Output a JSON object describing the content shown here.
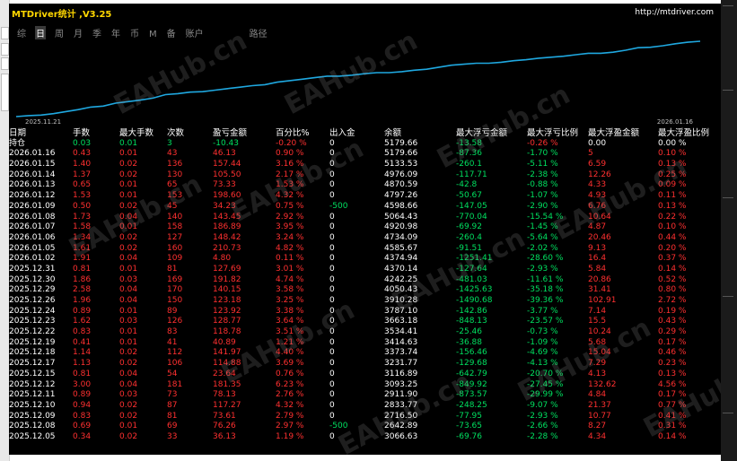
{
  "app": {
    "title": "MTDriver统计 ,V3.25",
    "url": "http://mtdriver.com"
  },
  "tabs": [
    {
      "label": "综",
      "active": false
    },
    {
      "label": "日",
      "active": true
    },
    {
      "label": "周",
      "active": false
    },
    {
      "label": "月",
      "active": false
    },
    {
      "label": "季",
      "active": false
    },
    {
      "label": "年",
      "active": false
    },
    {
      "label": "币",
      "active": false
    },
    {
      "label": "M",
      "active": false
    },
    {
      "label": "备",
      "active": false
    },
    {
      "label": "账户",
      "active": false
    },
    {
      "label": "路径",
      "active": false
    }
  ],
  "watermark": "EAHub.cn",
  "chart_data": {
    "type": "line",
    "x_start_label": "2025.11.21",
    "x_end_label": "2026.01.16",
    "line_color": "#1fa8e0",
    "grid": false,
    "values": [
      0,
      2,
      3,
      6,
      10,
      14,
      19,
      21,
      27,
      30,
      33,
      37,
      44,
      46,
      49,
      50,
      53,
      56,
      59,
      62,
      64,
      69,
      72,
      75,
      78,
      81,
      81,
      83,
      86,
      88,
      88,
      90,
      93,
      95,
      99,
      103,
      105,
      107,
      107,
      109,
      112,
      114,
      117,
      119,
      121,
      124,
      127,
      127,
      129,
      133,
      138,
      139,
      142,
      146,
      149,
      151
    ]
  },
  "table": {
    "headers": [
      "日期",
      "手数",
      "最大手数",
      "次数",
      "盈亏金额",
      "百分比%",
      "出入金",
      "余额",
      "最大浮亏金额",
      "最大浮亏比例",
      "最大浮盈金额",
      "最大浮盈比例"
    ],
    "holding": {
      "date": "持仓",
      "lots": "0.03",
      "max_lots": "0.01",
      "count": "3",
      "pnl": "-10.43",
      "pct": "-0.20 %",
      "io": "0",
      "balance": "5179.66",
      "max_float_loss": "-13.58",
      "max_float_loss_pct": "-0.26 %",
      "max_float_profit": "0.00",
      "max_float_profit_pct": "0.00 %"
    },
    "rows": [
      [
        "2026.01.16",
        "0.43",
        "0.01",
        "43",
        "46.13",
        "0.90 %",
        "0",
        "5179.66",
        "-87.36",
        "-1.70 %",
        "5",
        "0.10 %"
      ],
      [
        "2026.01.15",
        "1.40",
        "0.02",
        "136",
        "157.44",
        "3.16 %",
        "0",
        "5133.53",
        "-260.1",
        "-5.11 %",
        "6.59",
        "0.13 %"
      ],
      [
        "2026.01.14",
        "1.37",
        "0.02",
        "130",
        "105.50",
        "2.17 %",
        "0",
        "4976.09",
        "-117.71",
        "-2.38 %",
        "12.26",
        "0.25 %"
      ],
      [
        "2026.01.13",
        "0.65",
        "0.01",
        "65",
        "73.33",
        "1.53 %",
        "0",
        "4870.59",
        "-42.8",
        "-0.88 %",
        "4.33",
        "0.09 %"
      ],
      [
        "2026.01.12",
        "1.53",
        "0.01",
        "153",
        "198.60",
        "4.32 %",
        "0",
        "4797.26",
        "-50.67",
        "-1.07 %",
        "4.93",
        "0.11 %"
      ],
      [
        "2026.01.09",
        "0.50",
        "0.02",
        "45",
        "34.23",
        "0.75 %",
        "-500",
        "4598.66",
        "-147.05",
        "-2.90 %",
        "6.76",
        "0.13 %"
      ],
      [
        "2026.01.08",
        "1.73",
        "0.04",
        "140",
        "143.45",
        "2.92 %",
        "0",
        "5064.43",
        "-770.04",
        "-15.54 %",
        "10.64",
        "0.22 %"
      ],
      [
        "2026.01.07",
        "1.58",
        "0.01",
        "158",
        "186.89",
        "3.95 %",
        "0",
        "4920.98",
        "-69.92",
        "-1.45 %",
        "4.87",
        "0.10 %"
      ],
      [
        "2026.01.06",
        "1.34",
        "0.02",
        "127",
        "148.42",
        "3.24 %",
        "0",
        "4734.09",
        "-260.4",
        "-5.64 %",
        "20.46",
        "0.44 %"
      ],
      [
        "2026.01.05",
        "1.61",
        "0.02",
        "160",
        "210.73",
        "4.82 %",
        "0",
        "4585.67",
        "-91.51",
        "-2.02 %",
        "9.13",
        "0.20 %"
      ],
      [
        "2026.01.02",
        "1.91",
        "0.04",
        "109",
        "4.80",
        "0.11 %",
        "0",
        "4374.94",
        "-1251.41",
        "-28.60 %",
        "16.4",
        "0.37 %"
      ],
      [
        "2025.12.31",
        "0.81",
        "0.01",
        "81",
        "127.69",
        "3.01 %",
        "0",
        "4370.14",
        "-127.64",
        "-2.93 %",
        "5.84",
        "0.14 %"
      ],
      [
        "2025.12.30",
        "1.86",
        "0.03",
        "169",
        "191.82",
        "4.74 %",
        "0",
        "4242.25",
        "-481.03",
        "-11.61 %",
        "20.86",
        "0.52 %"
      ],
      [
        "2025.12.29",
        "2.58",
        "0.04",
        "170",
        "140.15",
        "3.58 %",
        "0",
        "4050.43",
        "-1425.63",
        "-35.18 %",
        "31.41",
        "0.80 %"
      ],
      [
        "2025.12.26",
        "1.96",
        "0.04",
        "150",
        "123.18",
        "3.25 %",
        "0",
        "3910.28",
        "-1490.68",
        "-39.36 %",
        "102.91",
        "2.72 %"
      ],
      [
        "2025.12.24",
        "0.89",
        "0.01",
        "89",
        "123.92",
        "3.38 %",
        "0",
        "3787.10",
        "-142.86",
        "-3.77 %",
        "7.14",
        "0.19 %"
      ],
      [
        "2025.12.23",
        "1.62",
        "0.03",
        "126",
        "128.77",
        "3.64 %",
        "0",
        "3663.18",
        "-848.13",
        "-23.57 %",
        "15.5",
        "0.43 %"
      ],
      [
        "2025.12.22",
        "0.83",
        "0.01",
        "83",
        "118.78",
        "3.51 %",
        "0",
        "3534.41",
        "-25.46",
        "-0.73 %",
        "10.24",
        "0.29 %"
      ],
      [
        "2025.12.19",
        "0.41",
        "0.01",
        "41",
        "40.89",
        "1.21 %",
        "0",
        "3414.63",
        "-36.88",
        "-1.09 %",
        "5.68",
        "0.17 %"
      ],
      [
        "2025.12.18",
        "1.14",
        "0.02",
        "112",
        "141.97",
        "4.40 %",
        "0",
        "3373.74",
        "-156.46",
        "-4.69 %",
        "15.04",
        "0.46 %"
      ],
      [
        "2025.12.17",
        "1.13",
        "0.02",
        "106",
        "114.88",
        "3.69 %",
        "0",
        "3231.77",
        "-129.68",
        "-4.13 %",
        "7.29",
        "0.23 %"
      ],
      [
        "2025.12.15",
        "0.81",
        "0.04",
        "54",
        "23.64",
        "0.76 %",
        "0",
        "3116.89",
        "-642.79",
        "-20.70 %",
        "4.13",
        "0.13 %"
      ],
      [
        "2025.12.12",
        "3.00",
        "0.04",
        "181",
        "181.35",
        "6.23 %",
        "0",
        "3093.25",
        "-849.92",
        "-27.45 %",
        "132.62",
        "4.56 %"
      ],
      [
        "2025.12.11",
        "0.89",
        "0.03",
        "73",
        "78.13",
        "2.76 %",
        "0",
        "2911.90",
        "-873.57",
        "-29.99 %",
        "4.84",
        "0.17 %"
      ],
      [
        "2025.12.10",
        "0.94",
        "0.02",
        "87",
        "117.27",
        "4.32 %",
        "0",
        "2833.77",
        "-248.25",
        "-9.07 %",
        "21.37",
        "0.77 %"
      ],
      [
        "2025.12.09",
        "0.83",
        "0.02",
        "81",
        "73.61",
        "2.79 %",
        "0",
        "2716.50",
        "-77.95",
        "-2.93 %",
        "10.77",
        "0.41 %"
      ],
      [
        "2025.12.08",
        "0.69",
        "0.01",
        "69",
        "76.26",
        "2.97 %",
        "-500",
        "2642.89",
        "-73.65",
        "-2.66 %",
        "8.27",
        "0.31 %"
      ],
      [
        "2025.12.05",
        "0.34",
        "0.02",
        "33",
        "36.13",
        "1.19 %",
        "0",
        "3066.63",
        "-69.76",
        "-2.28 %",
        "4.34",
        "0.14 %"
      ]
    ]
  }
}
